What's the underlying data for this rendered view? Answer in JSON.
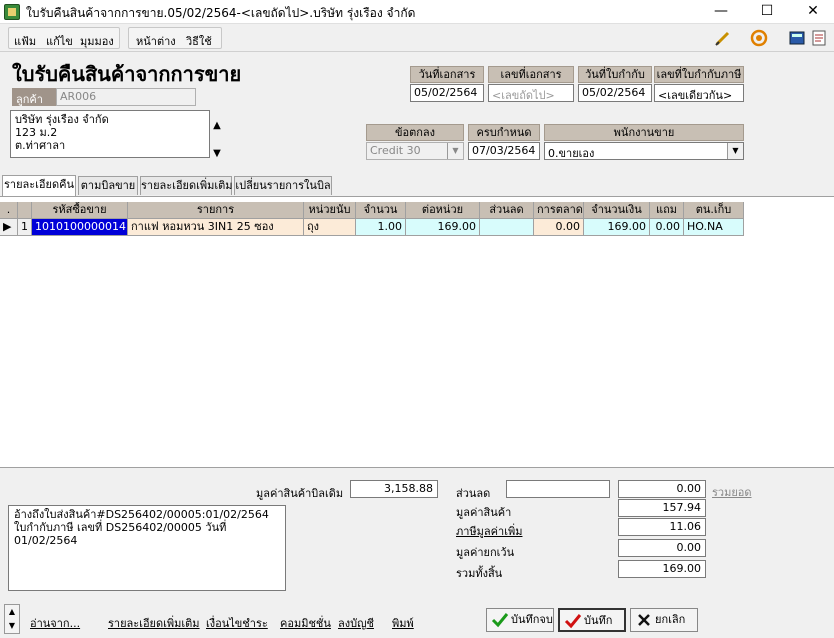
{
  "window": {
    "title": "ใบรับคืนสินค้าจากการขาย.05/02/2564-<เลขถัดไป>.บริษัท รุ่งเรือง จำกัด",
    "min": "—",
    "max": "☐",
    "close": "✕"
  },
  "menu": {
    "file": "แฟ้ม",
    "edit": "แก้ไข",
    "view": "มุมมอง",
    "window": "หน้าต่าง",
    "help": "วิธีใช้"
  },
  "page_title": "ใบรับคืนสินค้าจากการขาย",
  "customer": {
    "label": "ลูกค้า",
    "code": "AR006",
    "address_lines": [
      "บริษัท รุ่งเรือง จำกัด",
      "123 ม.2",
      "ต.ท่าศาลา"
    ]
  },
  "doc": {
    "date_label": "วันที่เอกสาร",
    "date_value": "05/02/2564",
    "no_label": "เลขที่เอกสาร",
    "no_value": "<เลขถัดไป>",
    "invoice_date_label": "วันที่ใบกำกับ",
    "invoice_date_value": "05/02/2564",
    "tax_invoice_label": "เลขที่ใบกำกับภาษี",
    "tax_invoice_value": "<เลขเดียวกัน>"
  },
  "terms": {
    "label": "ข้อตกลง",
    "value": "Credit 30",
    "due_label": "ครบกำหนด",
    "due_value": "07/03/2564",
    "salesperson_label": "พนักงานขาย",
    "salesperson_value": "0.ขายเอง"
  },
  "tabs": [
    "รายละเอียดคืน",
    "ตามบิลขาย",
    "รายละเอียดเพิ่มเติม",
    "เปลี่ยนรายการในบิล"
  ],
  "grid": {
    "columns": [
      ".",
      "รหัสซื้อขาย",
      "รายการ",
      "หน่วยนับ",
      "จำนวน",
      "ต่อหน่วย",
      "ส่วนลด",
      "การตลาด",
      "จำนวนเงิน",
      "แถม",
      "ตน.เก็บ"
    ],
    "rows": [
      {
        "no": "1",
        "code": "1010100000014",
        "desc": "กาแฟ หอมหวน 3IN1 25 ซอง",
        "unit": "ถุง",
        "qty": "1.00",
        "price": "169.00",
        "discount": "",
        "marketing": "0.00",
        "amount": "169.00",
        "free": "0.00",
        "location": "HO.NA"
      }
    ]
  },
  "summary": {
    "orig_label": "มูลค่าสินค้าบิลเดิม",
    "orig_value": "3,158.88",
    "discount_label": "ส่วนลด",
    "discount_input": "",
    "discount_value": "0.00",
    "total_link": "รวมยอด",
    "goods_label": "มูลค่าสินค้า",
    "goods_value": "157.94",
    "vat_label": "ภาษีมูลค่าเพิ่ม",
    "vat_value": "11.06",
    "exempt_label": "มูลค่ายกเว้น",
    "exempt_value": "0.00",
    "grand_label": "รวมทั้งสิ้น",
    "grand_value": "169.00"
  },
  "note_lines": [
    "อ้างถึงใบส่งสินค้า#DS256402/00005:01/02/2564",
    "ใบกำกับภาษี เลขที่ DS256402/00005 วันที่ 01/02/2564"
  ],
  "footer_links": {
    "read_from": "อ่านจาก...",
    "more_detail": "รายละเอียดเพิ่มเติม",
    "payment_terms": "เงื่อนไขชำระ",
    "commission": "คอมมิชชั่น",
    "post_account": "ลงบัญชี",
    "print": "พิมพ์"
  },
  "buttons": {
    "save_close": "บันทึกจบ",
    "save": "บันทึก",
    "cancel": "ยกเลิก"
  },
  "colors": {
    "header_bg": "#c8bfb4",
    "selected_cell": "#0000d8",
    "peach": "#fcebd8",
    "cyan": "#d8fcfc"
  }
}
